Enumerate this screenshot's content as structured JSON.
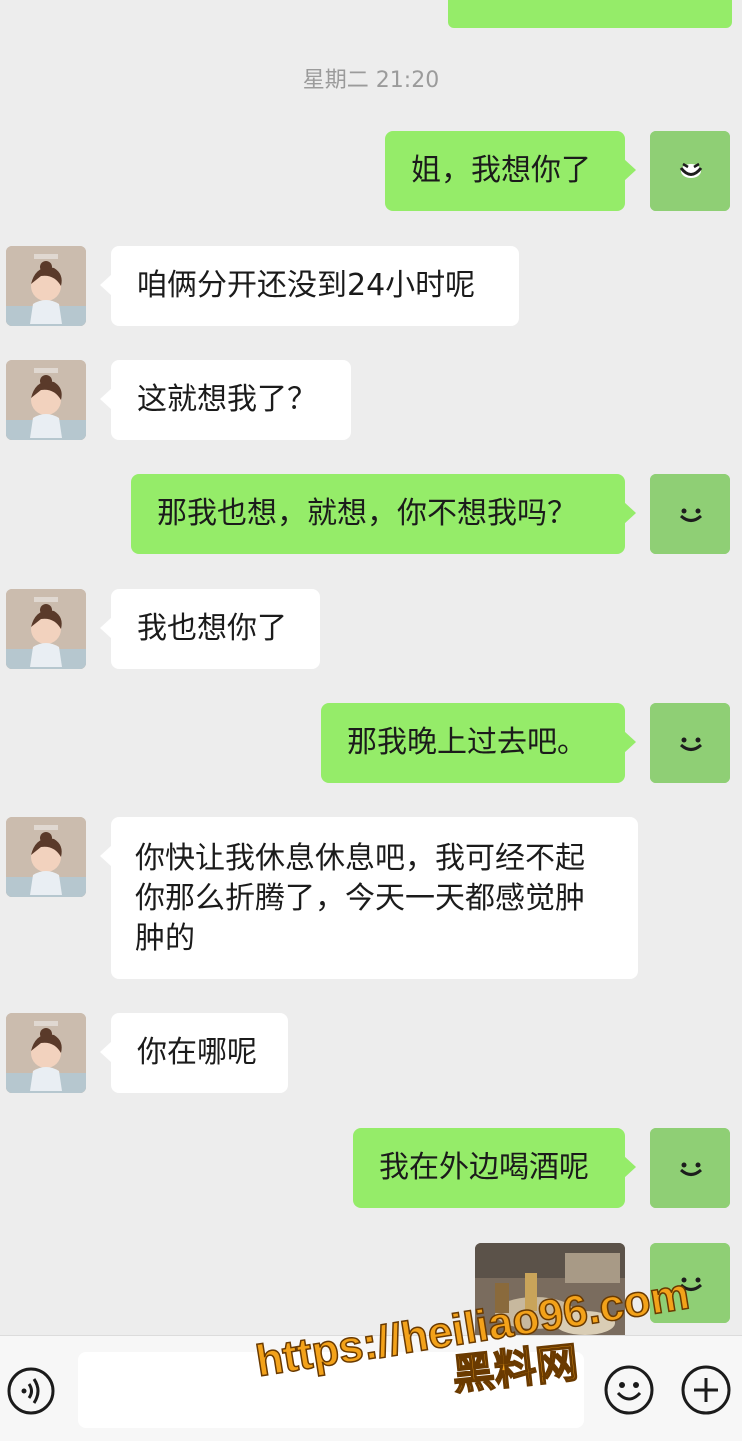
{
  "chat": {
    "timestamp": "星期二 21:20",
    "messages": [
      {
        "side": "out",
        "text": "姐，我想你了",
        "avatar": "emoji-avatar-icon"
      },
      {
        "side": "in",
        "text": "咱俩分开还没到24小时呢",
        "avatar": "cartoon-girl-avatar"
      },
      {
        "side": "in",
        "text": "这就想我了？",
        "avatar": "cartoon-girl-avatar"
      },
      {
        "side": "out",
        "text": "那我也想，就想，你不想我吗？",
        "avatar": "smile-avatar-icon"
      },
      {
        "side": "in",
        "text": "我也想你了",
        "avatar": "cartoon-girl-avatar"
      },
      {
        "side": "out",
        "text": "那我晚上过去吧。",
        "avatar": "smile-avatar-icon"
      },
      {
        "side": "in",
        "text": "你快让我休息休息吧，我可经不起你那么折腾了，今天一天都感觉肿肿的",
        "avatar": "cartoon-girl-avatar"
      },
      {
        "side": "in",
        "text": "你在哪呢",
        "avatar": "cartoon-girl-avatar"
      },
      {
        "side": "out",
        "text": "我在外边喝酒呢",
        "avatar": "smile-avatar-icon"
      },
      {
        "side": "out",
        "type": "image",
        "description_icon": "photo-thumbnail",
        "avatar": "smile-avatar-icon"
      }
    ]
  },
  "input_bar": {
    "voice_icon": "voice-icon",
    "emoji_icon": "emoji-icon",
    "plus_icon": "plus-icon"
  },
  "watermark": {
    "url": "https://heiliao96.com",
    "name": "黑料网"
  },
  "colors": {
    "background": "#ededed",
    "outgoing_bubble": "#95ec69",
    "incoming_bubble": "#ffffff",
    "watermark_fill": "#f3a21a"
  }
}
